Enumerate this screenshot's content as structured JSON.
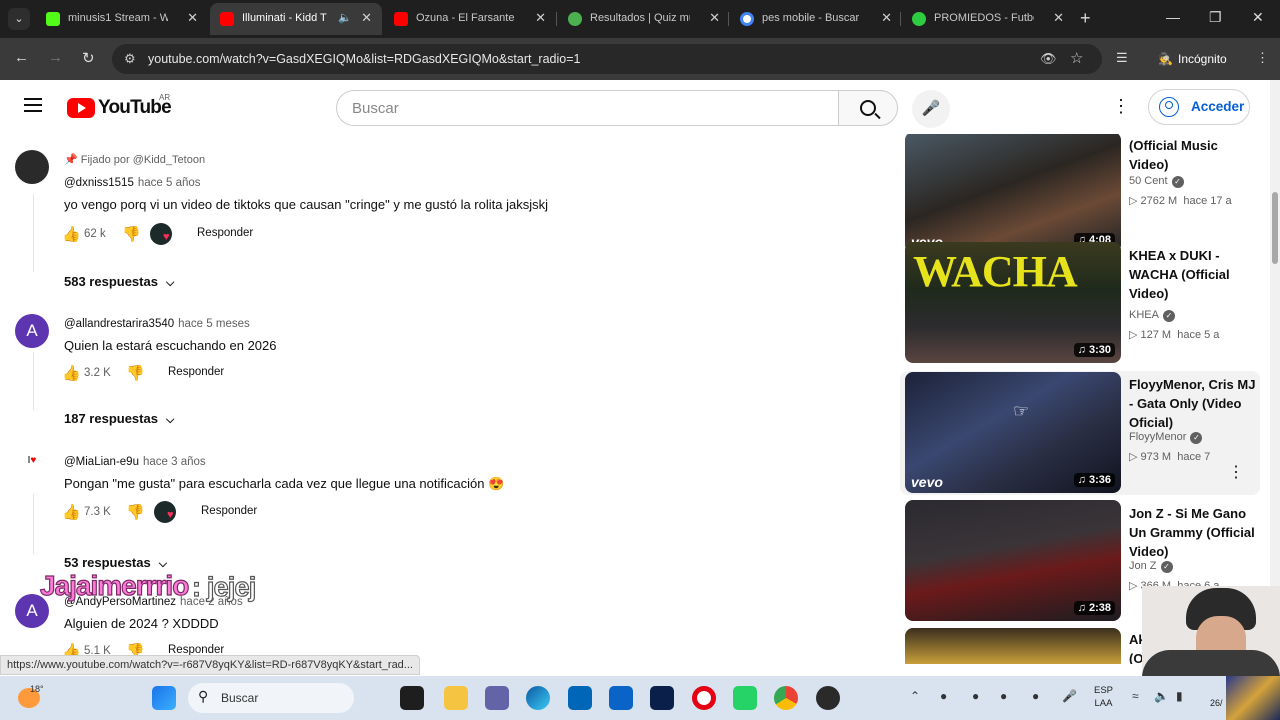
{
  "browser": {
    "tabs": [
      {
        "title": "minusis1 Stream - W",
        "favicon_color": "#53fc18",
        "active": false
      },
      {
        "title": "Illuminati - Kidd T",
        "favicon_color": "#ff0000",
        "active": true
      },
      {
        "title": "Ozuna - El Farsante (",
        "favicon_color": "#ff0000",
        "active": false
      },
      {
        "title": "Resultados | Quiz mu",
        "favicon_color": "#4caf50",
        "active": false
      },
      {
        "title": "pes mobile - Buscar c",
        "favicon_color": "#ffffff",
        "active": false
      },
      {
        "title": "PROMIEDOS - Futbol",
        "favicon_color": "#2ecc40",
        "active": false
      }
    ],
    "url": "youtube.com/watch?v=GasdXEGIQMo&list=RDGasdXEGIQMo&start_radio=1",
    "incognito_label": "Incógnito",
    "status_url": "https://www.youtube.com/watch?v=-r687V8yqKY&list=RD-r687V8yqKY&start_rad..."
  },
  "header": {
    "logo_text": "YouTube",
    "region": "AR",
    "search_placeholder": "Buscar",
    "signin_label": "Acceder"
  },
  "comments": [
    {
      "pinned_label": "Fijado por @Kidd_Tetoon",
      "author": "@dxniss1515",
      "ago": "hace 5 años",
      "text": "yo vengo porq vi un video de tiktoks que causan \"cringe\" y me gustó la rolita jaksjskj",
      "likes": "62 k",
      "reply_label": "Responder",
      "replies_label": "583 respuestas"
    },
    {
      "avatar_letter": "A",
      "author": "@allandrestarira3540",
      "ago": "hace 5 meses",
      "text": "Quien la estará escuchando en 2026",
      "likes": "3.2 K",
      "reply_label": "Responder",
      "replies_label": "187 respuestas"
    },
    {
      "author": "@MiaLian-e9u",
      "ago": "hace 3 años",
      "text": "Pongan \"me gusta\" para escucharla cada vez que llegue una notificación 😍",
      "likes": "7.3 K",
      "reply_label": "Responder",
      "replies_label": "53 respuestas"
    },
    {
      "avatar_letter": "A",
      "author": "@AndyPersoMartinez",
      "ago": "hace 2 años",
      "text": "Alguien de 2024 ? XDDDD",
      "likes": "5.1 K",
      "reply_label": "Responder"
    }
  ],
  "overlay": {
    "name": "Jajaimerrrio",
    "message": ": jejej"
  },
  "related": [
    {
      "title": "(Official Music Video)",
      "channel": "50 Cent",
      "views": "2762 M",
      "ago": "hace 17 a",
      "duration": "4:08",
      "vevo": "vevo"
    },
    {
      "title": "KHEA x DUKI - WACHA (Official Video)",
      "channel": "KHEA",
      "views": "127 M",
      "ago": "hace 5 a",
      "duration": "3:30",
      "thumb_text": "WACHA"
    },
    {
      "title": "FloyyMenor, Cris MJ - Gata Only (Video Oficial)",
      "channel": "FloyyMenor",
      "views": "973 M",
      "ago": "hace 7",
      "duration": "3:36",
      "vevo": "vevo"
    },
    {
      "title": "Jon Z - Si Me Gano Un Grammy (Official Video)",
      "channel": "Jon Z",
      "views": "366 M",
      "ago": "hace 6 a",
      "duration": "2:38"
    },
    {
      "title": "Ak",
      "subtitle": "(O"
    }
  ],
  "taskbar": {
    "search_label": "Buscar",
    "temperature": "18°",
    "lang_line1": "ESP",
    "lang_line2": "LAA",
    "clock": "26/"
  },
  "colors": {
    "youtube_red": "#ff0000",
    "link_blue": "#065fd4",
    "avatar_purple": "#5e35b1",
    "pink_overlay": "#ff7ad9"
  }
}
